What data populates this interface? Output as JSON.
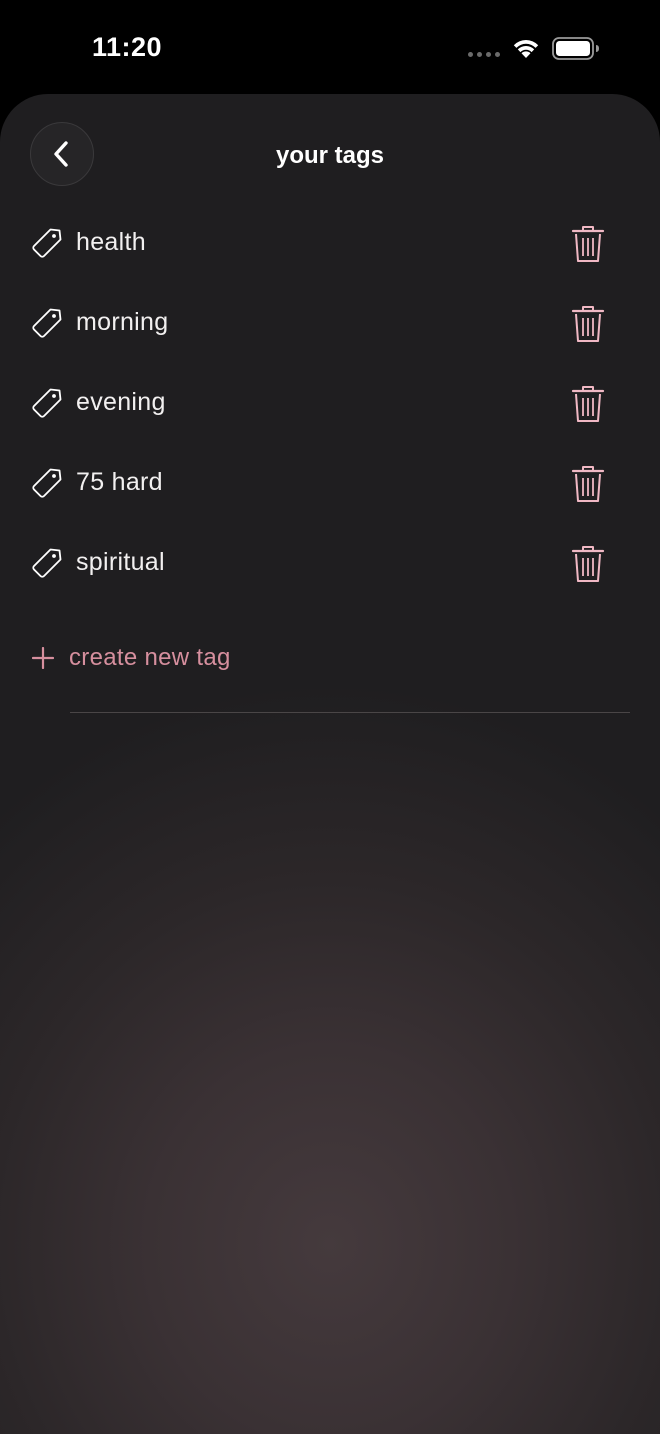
{
  "status_bar": {
    "time": "11:20"
  },
  "header": {
    "title": "your tags",
    "back_icon": "chevron-left-icon"
  },
  "tags": [
    {
      "label": "health"
    },
    {
      "label": "morning"
    },
    {
      "label": "evening"
    },
    {
      "label": "75 hard"
    },
    {
      "label": "spiritual"
    }
  ],
  "create": {
    "label": "create new tag",
    "icon": "plus-icon"
  },
  "colors": {
    "accent": "#d68f9e",
    "trash": "#f0b8c4",
    "text": "#f2f0f0",
    "background": "#1f1e20"
  }
}
